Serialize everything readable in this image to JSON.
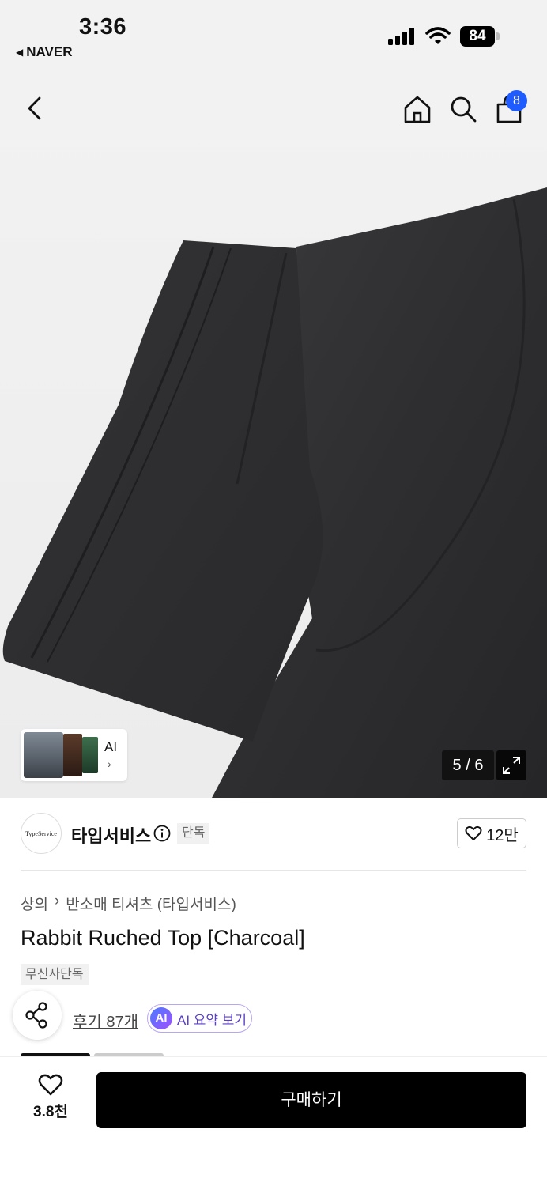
{
  "status_bar": {
    "time": "3:36",
    "back_app": "NAVER",
    "battery": "84"
  },
  "header": {
    "cart_badge": "8"
  },
  "gallery": {
    "counter": "5 / 6",
    "ai_thumb_label": "AI"
  },
  "store": {
    "logo_text": "TypeService",
    "name": "타입서비스",
    "exclusive_tag": "단독",
    "likes": "12만"
  },
  "product": {
    "breadcrumb": [
      "상의",
      "반소매 티셔츠 (타입서비스)"
    ],
    "title": "Rabbit Ruched Top [Charcoal]",
    "tag": "무신사단독",
    "review_text": "후기 87개",
    "ai_summary_badge": "AI",
    "ai_summary_label": "AI 요약 보기"
  },
  "bottom_bar": {
    "fav_count": "3.8천",
    "buy_label": "구매하기"
  },
  "colors": {
    "accent_blue": "#1f5cff",
    "ai_purple": "#5b3fc7",
    "buy_button": "#000000"
  }
}
